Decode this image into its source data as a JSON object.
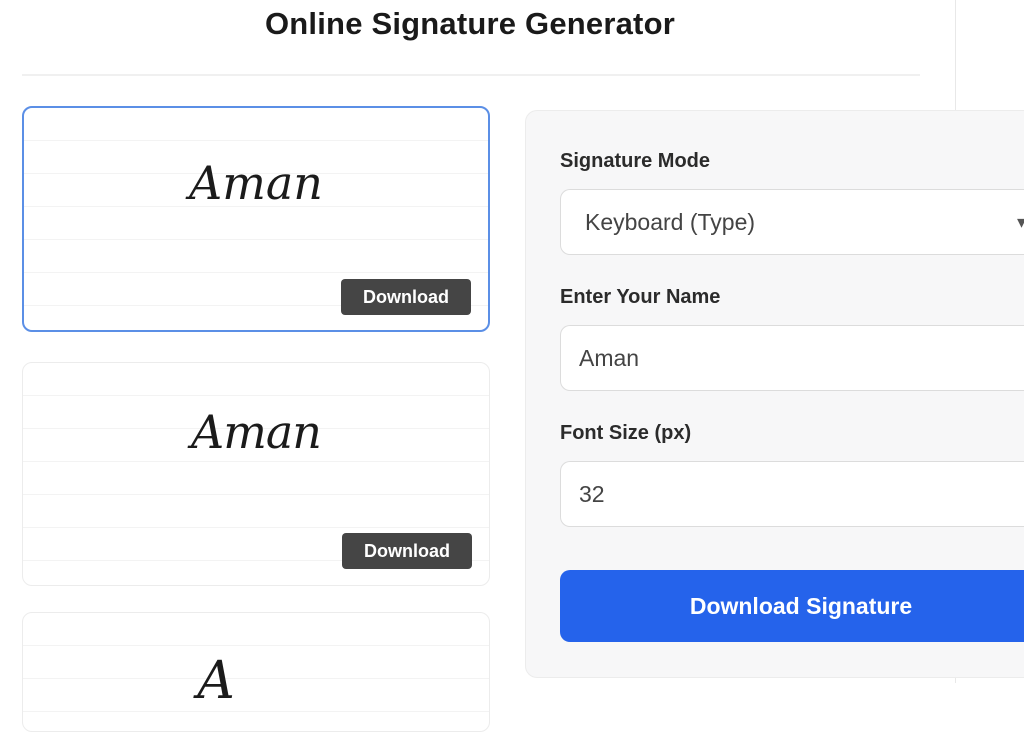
{
  "page": {
    "title": "Online Signature Generator"
  },
  "signatures": [
    {
      "text": "Aman",
      "download_label": "Download"
    },
    {
      "text": "Aman",
      "download_label": "Download"
    },
    {
      "text": "A"
    }
  ],
  "form": {
    "mode_label": "Signature Mode",
    "mode_value": "Keyboard (Type)",
    "name_label": "Enter Your Name",
    "name_value": "Aman",
    "font_size_label": "Font Size (px)",
    "font_size_value": "32",
    "submit_label": "Download Signature"
  },
  "colors": {
    "primary": "#2563eb",
    "download_button": "#454545",
    "selected_border": "#5b8fe6"
  },
  "icons": {
    "mode_select": "chevron-down-icon"
  }
}
